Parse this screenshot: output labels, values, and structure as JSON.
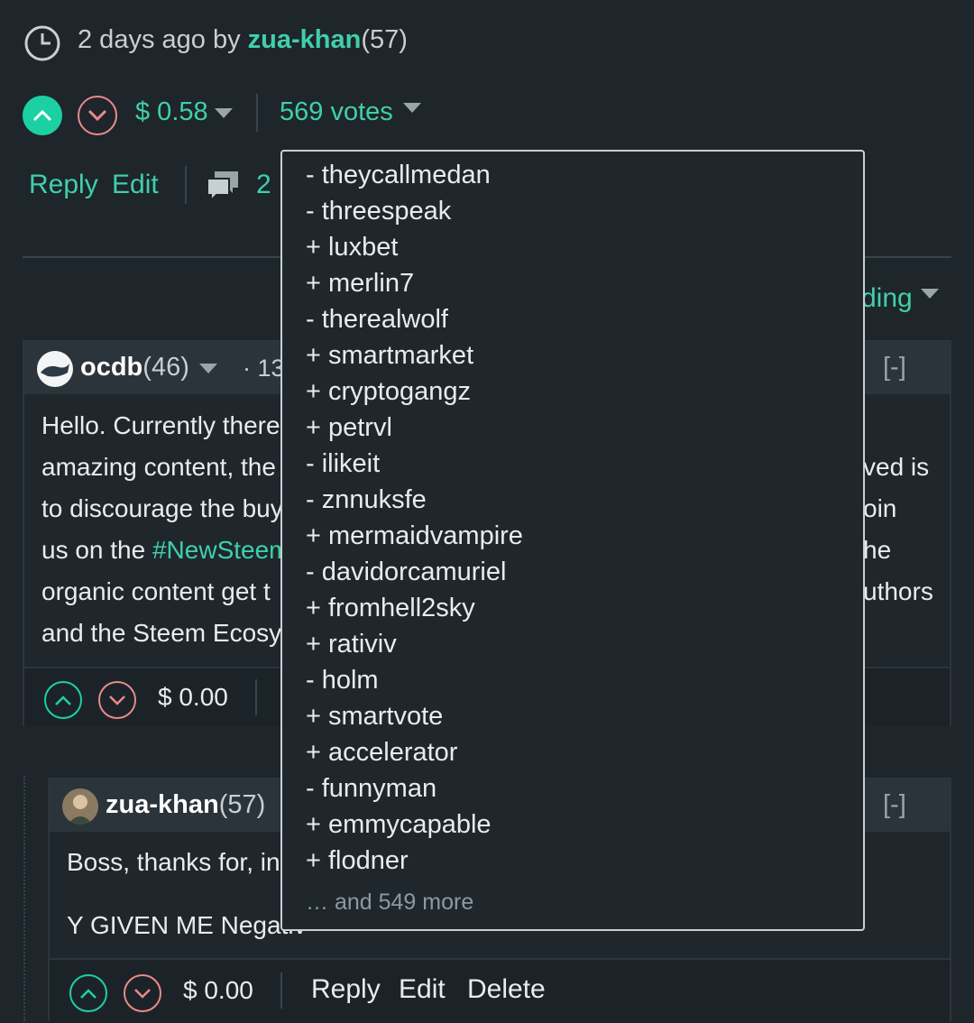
{
  "post": {
    "time_ago": "2 days ago by",
    "author": "zua-khan",
    "author_rep": "(57)",
    "payout": "$ 0.58",
    "votes": "569 votes",
    "reply_label": "Reply",
    "edit_label": "Edit",
    "comments_count": "2",
    "sort_partial": "ding"
  },
  "votes_dropdown": {
    "items": [
      "- theycallmedan",
      "- threespeak",
      "+ luxbet",
      "+ merlin7",
      "- therealwolf",
      "+ smartmarket",
      "+ cryptogangz",
      "+ petrvl",
      "- ilikeit",
      "- znnuksfe",
      "+ mermaidvampire",
      "- davidorcamuriel",
      "+ fromhell2sky",
      "+ rativiv",
      "- holm",
      "+ smartvote",
      "+ accelerator",
      "- funnyman",
      "+ emmycapable",
      "+ flodner"
    ],
    "more": "… and 549 more"
  },
  "comment1": {
    "author": "ocdb",
    "rep": "(46)",
    "time_partial": "· 13",
    "collapse": "[-]",
    "lines_left": [
      "Hello. Currently there",
      "amazing content, the",
      "to discourage the buy",
      "us on the ",
      "organic content get t",
      "and the Steem Ecosy"
    ],
    "hashtag": "#NewSteem",
    "lines_right": [
      "ved is",
      "oin",
      "he",
      "uthors"
    ],
    "payout": "$ 0.00"
  },
  "comment2": {
    "author": "zua-khan",
    "rep": "(57)",
    "collapse": "[-]",
    "line1": "Boss, thanks for, in",
    "line2": "Y GIVEN ME Negativ",
    "payout": "$ 0.00",
    "reply_label": "Reply",
    "edit_label": "Edit",
    "delete_label": "Delete"
  }
}
